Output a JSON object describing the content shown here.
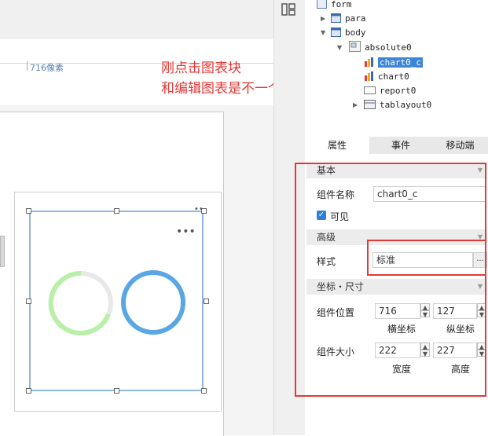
{
  "canvas": {
    "pixel_label": "716像素",
    "annotation_line1": "刚点击图表块",
    "annotation_line2": "和编辑图表是不一个界面",
    "more_label": "•••",
    "corner_more_label": "••"
  },
  "tree": {
    "nodes": [
      {
        "label": "form",
        "icon": "form-icon"
      },
      {
        "label": "para",
        "icon": "panel-icon"
      },
      {
        "label": "body",
        "icon": "panel-icon"
      },
      {
        "label": "absolute0",
        "icon": "absolute-layout-icon"
      },
      {
        "label": "chart0_c",
        "icon": "chart-icon",
        "selected": true
      },
      {
        "label": "chart0",
        "icon": "chart-icon"
      },
      {
        "label": "report0",
        "icon": "report-icon"
      },
      {
        "label": "tablayout0",
        "icon": "tab-layout-icon"
      }
    ]
  },
  "tabs": {
    "properties": "属性",
    "events": "事件",
    "mobile": "移动端"
  },
  "props": {
    "basic_section": "基本",
    "name_label": "组件名称",
    "name_value": "chart0_c",
    "visible_label": "可见",
    "visible_checked": true,
    "advanced_section": "高级",
    "style_label": "样式",
    "style_value": "标准",
    "style_more": "...",
    "coords_section": "坐标・尺寸",
    "position_label": "组件位置",
    "pos_x": "716",
    "pos_y": "127",
    "x_caption": "横坐标",
    "y_caption": "纵坐标",
    "size_label": "组件大小",
    "width_value": "222",
    "height_value": "227",
    "width_caption": "宽度",
    "height_caption": "高度"
  },
  "colors": {
    "annotation": "#e53935",
    "selection": "#3b86d6",
    "donut_green": "#b8f0a8",
    "donut_blue": "#5aa7e6",
    "frame_blue": "#8fb7e6"
  }
}
